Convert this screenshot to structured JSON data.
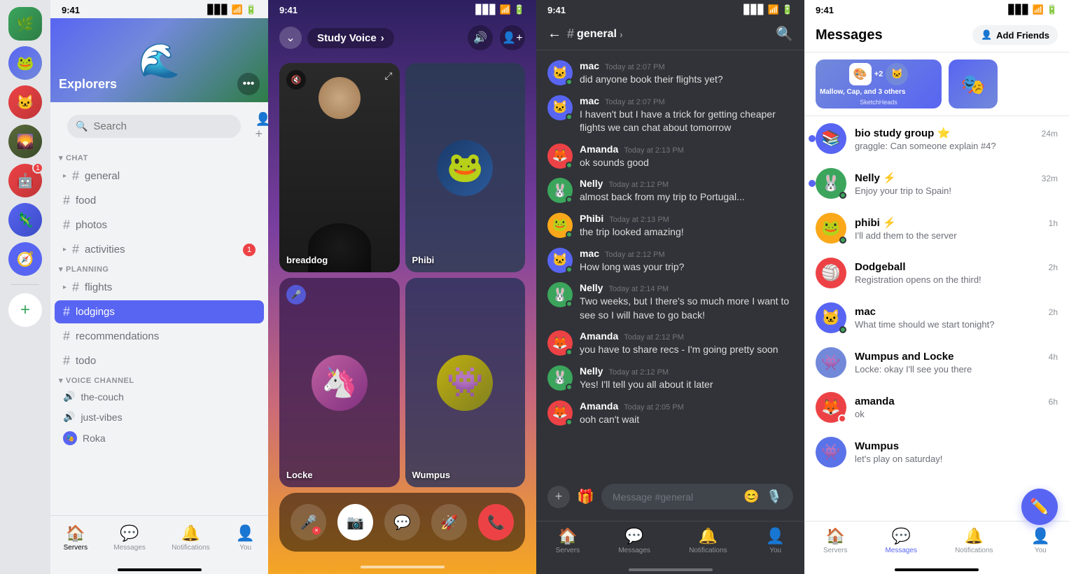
{
  "panel1": {
    "status_bar": {
      "time": "9:41",
      "signal": "▊▊▊",
      "wifi": "wifi",
      "battery": "battery"
    },
    "server_name": "Explorers",
    "search_placeholder": "Search",
    "sections": {
      "chat": {
        "label": "CHAT",
        "channels": [
          {
            "name": "general",
            "active": false
          },
          {
            "name": "food",
            "active": false
          },
          {
            "name": "photos",
            "active": false
          },
          {
            "name": "activities",
            "active": false,
            "badge": "1"
          }
        ]
      },
      "planning": {
        "label": "PLANNING",
        "channels": [
          {
            "name": "flights",
            "active": false,
            "has_arrow": true
          },
          {
            "name": "lodgings",
            "active": true
          },
          {
            "name": "recommendations",
            "active": false
          },
          {
            "name": "todo",
            "active": false
          }
        ]
      },
      "voice": {
        "label": "VOICE CHANNEL",
        "channels": [
          {
            "name": "the-couch"
          },
          {
            "name": "just-vibes"
          }
        ]
      },
      "user": {
        "name": "Roka"
      }
    },
    "bottom_nav": [
      {
        "label": "Servers",
        "active": true,
        "icon": "🏠"
      },
      {
        "label": "Messages",
        "active": false,
        "icon": "💬"
      },
      {
        "label": "Notifications",
        "active": false,
        "icon": "🔔"
      },
      {
        "label": "You",
        "active": false,
        "icon": "👤"
      }
    ]
  },
  "panel2": {
    "status_bar": {
      "time": "9:41"
    },
    "call_title": "Study Voice",
    "participants": [
      {
        "name": "breaddog",
        "is_video": true,
        "muted": true
      },
      {
        "name": "Phibi",
        "is_video": false,
        "emoji": "🐸"
      },
      {
        "name": "Locke",
        "is_video": false,
        "emoji": "🦄",
        "muted": true
      },
      {
        "name": "Wumpus",
        "is_video": false,
        "emoji": "👾"
      }
    ],
    "controls": [
      {
        "id": "mute",
        "icon": "🎤",
        "style": "dark"
      },
      {
        "id": "video",
        "icon": "📷",
        "style": "white"
      },
      {
        "id": "chat",
        "icon": "💬",
        "style": "dark"
      },
      {
        "id": "boost",
        "icon": "🚀",
        "style": "dark"
      },
      {
        "id": "end",
        "icon": "📞",
        "style": "red"
      }
    ]
  },
  "panel3": {
    "status_bar": {
      "time": "9:41"
    },
    "channel_name": "general",
    "messages": [
      {
        "user": "mac",
        "avatar_color": "#5865f2",
        "avatar_emoji": "🐱",
        "time": "Today at 2:07 PM",
        "text": "did anyone book their flights yet?",
        "status": "online"
      },
      {
        "user": "mac",
        "avatar_color": "#5865f2",
        "avatar_emoji": "🐱",
        "time": "Today at 2:07 PM",
        "text": "I haven't but I have a trick for getting cheaper flights we can chat about tomorrow",
        "status": "online"
      },
      {
        "user": "Amanda",
        "avatar_color": "#ed4245",
        "avatar_emoji": "🦊",
        "time": "Today at 2:13 PM",
        "text": "ok sounds good",
        "status": "online"
      },
      {
        "user": "Nelly",
        "avatar_color": "#3ba55c",
        "avatar_emoji": "🐰",
        "time": "Today at 2:12 PM",
        "text": "almost back from my trip to Portugal...",
        "status": "online"
      },
      {
        "user": "Phibi",
        "avatar_color": "#faa81a",
        "avatar_emoji": "🐸",
        "time": "Today at 2:13 PM",
        "text": "the trip looked amazing!",
        "status": "online"
      },
      {
        "user": "mac",
        "avatar_color": "#5865f2",
        "avatar_emoji": "🐱",
        "time": "Today at 2:12 PM",
        "text": "How long was your trip?",
        "status": "online"
      },
      {
        "user": "Nelly",
        "avatar_color": "#3ba55c",
        "avatar_emoji": "🐰",
        "time": "Today at 2:14 PM",
        "text": "Two weeks, but I there's so much more I want to see so I will have to go back!",
        "status": "online"
      },
      {
        "user": "Amanda",
        "avatar_color": "#ed4245",
        "avatar_emoji": "🦊",
        "time": "Today at 2:12 PM",
        "text": "you have to share recs - I'm going pretty soon",
        "status": "online"
      },
      {
        "user": "Nelly",
        "avatar_color": "#3ba55c",
        "avatar_emoji": "🐰",
        "time": "Today at 2:12 PM",
        "text": "Yes! I'll tell you all about it later",
        "status": "online"
      },
      {
        "user": "Amanda",
        "avatar_color": "#ed4245",
        "avatar_emoji": "🦊",
        "time": "Today at 2:05 PM",
        "text": "ooh can't wait",
        "status": "online"
      }
    ],
    "input_placeholder": "Message #general",
    "bottom_nav": [
      {
        "label": "Servers",
        "active": false,
        "icon": "🏠"
      },
      {
        "label": "Messages",
        "active": false,
        "icon": "💬"
      },
      {
        "label": "Notifications",
        "active": false,
        "icon": "🔔"
      },
      {
        "label": "You",
        "active": false,
        "icon": "👤"
      }
    ]
  },
  "panel4": {
    "status_bar": {
      "time": "9:41"
    },
    "title": "Messages",
    "add_friends_label": "Add Friends",
    "story_cards": [
      {
        "emoji": "🎨",
        "label": "SketchHeads",
        "bg": "#7289da"
      },
      {
        "emoji": "🎭",
        "label": "",
        "bg": "#ed4245"
      }
    ],
    "conversations": [
      {
        "name": "Mallow, Cap, and 3 others",
        "subtitle": "SketchHeads",
        "preview": "",
        "time": "",
        "avatar_emoji": "🎨",
        "avatar_bg": "#7289da",
        "unread": false,
        "is_story": true
      },
      {
        "name": "bio study group ⭐",
        "preview": "graggle: Can someone explain #4?",
        "time": "24m",
        "avatar_emoji": "📚",
        "avatar_bg": "#5865f2",
        "unread": true
      },
      {
        "name": "Nelly ⚡",
        "preview": "Enjoy your trip to Spain!",
        "time": "32m",
        "avatar_emoji": "🐰",
        "avatar_bg": "#3ba55c",
        "unread": true
      },
      {
        "name": "phibi ⚡",
        "preview": "I'll add them to the server",
        "time": "1h",
        "avatar_emoji": "🐸",
        "avatar_bg": "#faa81a",
        "unread": false
      },
      {
        "name": "Dodgeball",
        "preview": "Registration opens on the third!",
        "time": "2h",
        "avatar_emoji": "🏐",
        "avatar_bg": "#ed4245",
        "unread": false
      },
      {
        "name": "mac",
        "preview": "What time should we start tonight?",
        "time": "2h",
        "avatar_emoji": "🐱",
        "avatar_bg": "#5865f2",
        "unread": false,
        "status": "online"
      },
      {
        "name": "Wumpus and Locke",
        "preview": "Locke: okay I'll see you there",
        "time": "4h",
        "avatar_emoji": "👾",
        "avatar_bg": "#7289da",
        "unread": false
      },
      {
        "name": "amanda",
        "preview": "ok",
        "time": "6h",
        "avatar_emoji": "🦊",
        "avatar_bg": "#ed4245",
        "unread": false,
        "status": "dnd"
      },
      {
        "name": "Wumpus",
        "preview": "let's play on saturday!",
        "time": "",
        "avatar_emoji": "👾",
        "avatar_bg": "#5b73e8",
        "unread": false
      }
    ],
    "bottom_nav": [
      {
        "label": "Servers",
        "active": false,
        "icon": "🏠"
      },
      {
        "label": "Messages",
        "active": true,
        "icon": "💬"
      },
      {
        "label": "Notifications",
        "active": false,
        "icon": "🔔"
      },
      {
        "label": "You",
        "active": false,
        "icon": "👤"
      }
    ],
    "fab_icon": "✏️"
  }
}
